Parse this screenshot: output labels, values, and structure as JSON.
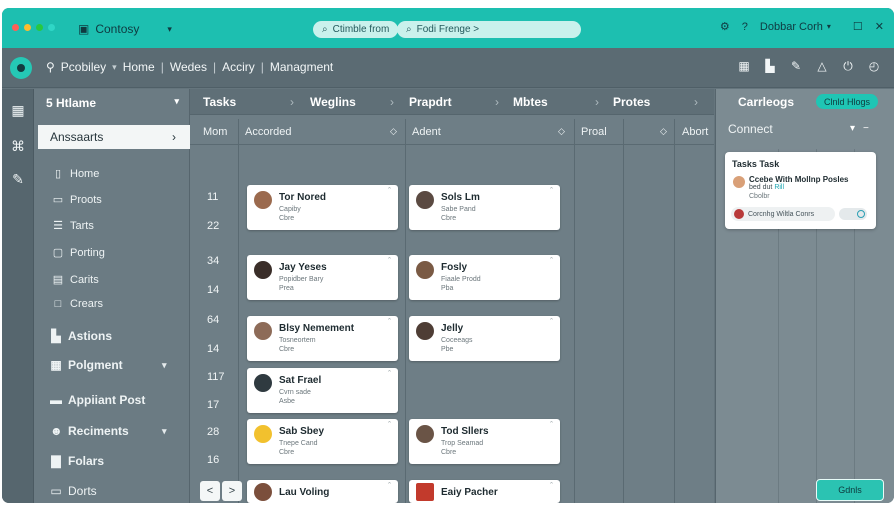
{
  "colors": {
    "accent": "#1dbfb0",
    "window_bg": "#65757d",
    "card_bg": "#ffffff",
    "traffic_lights": [
      "#ff5f57",
      "#febc2e",
      "#28c840",
      "#2fd6c6"
    ]
  },
  "topbar": {
    "app_name": "Contosy",
    "search_pill_1": "Ctimble from",
    "search_pill_2": "Fodi Frenge >",
    "user": "Dobbar Corh"
  },
  "navbar": {
    "breadcrumbs": [
      "Pcobiley",
      "Home",
      "Wedes",
      "Acciry",
      "Managment"
    ]
  },
  "sidebar": {
    "header": "5 Htlame",
    "active_item": "Anssaarts",
    "items": [
      "Home",
      "Proots",
      "Tarts",
      "Porting",
      "Carits",
      "Crears"
    ],
    "sections": [
      "Astions",
      "Polgment",
      "Appiiant Post",
      "Reciments",
      "Folars",
      "Dorts"
    ]
  },
  "board": {
    "tabs": [
      "Tasks",
      "Weglins",
      "Prapdrt",
      "Mbtes",
      "Protes"
    ],
    "columns": [
      "Mom",
      "Accorded",
      "Adent",
      "Proal",
      "Abort"
    ],
    "row_labels": [
      "11",
      "22",
      "34",
      "14",
      "64",
      "14",
      "117",
      "17",
      "28",
      "16"
    ],
    "cards": [
      {
        "name": "Tor Nored",
        "line1": "Capiby",
        "line2": "Cbre"
      },
      {
        "name": "Sols Lm",
        "line1": "Sabe Pand",
        "line2": "Cbre"
      },
      {
        "name": "Jay Yeses",
        "line1": "Popidber Bary",
        "line2": "Prea"
      },
      {
        "name": "Fosly",
        "line1": "Fiaale Prodd",
        "line2": "Pba"
      },
      {
        "name": "Blsy Nemement",
        "line1": "Tosneortem",
        "line2": "Cbre"
      },
      {
        "name": "Jelly",
        "line1": "Coceeags",
        "line2": "Pbe"
      },
      {
        "name": "Sat Frael",
        "line1": "Cvrn sade",
        "line2": "Asbe"
      },
      {
        "name": "Sab Sbey",
        "line1": "Tnepe Cand",
        "line2": "Cbre"
      },
      {
        "name": "Tod Sllers",
        "line1": "Trop Seamad",
        "line2": "Cbre"
      },
      {
        "name": "Lau Voling",
        "line1": "",
        "line2": ""
      },
      {
        "name": "Eaiy Pacher",
        "line1": "",
        "line2": ""
      }
    ],
    "pager_prev": "<",
    "pager_next": ">"
  },
  "right_panel": {
    "title": "Carrleogs",
    "button": "Clnld Hlogs",
    "subheader": "Connect",
    "task": {
      "title": "Tasks Task",
      "line1": "Ccebe With Mollnp Posles",
      "line2a": "bed dut",
      "line2b": "Rill",
      "line3": "Cbolbr",
      "pill": "Corcnhg Wiltla Conrs"
    },
    "bottom_button": "Gdnls"
  }
}
